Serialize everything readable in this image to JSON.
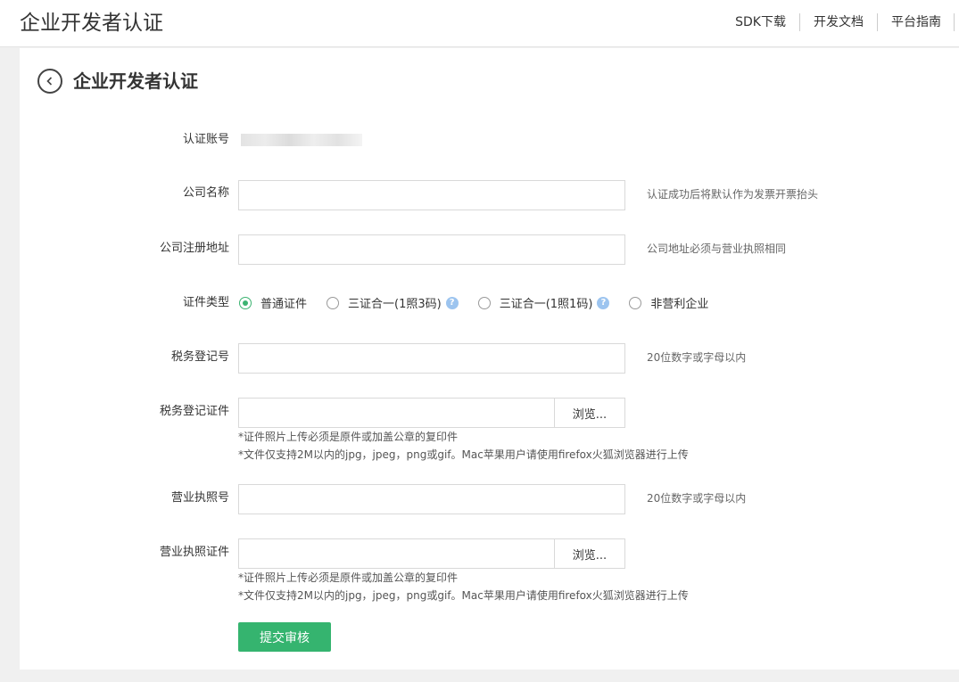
{
  "header": {
    "site_title": "企业开发者认证",
    "nav": [
      "SDK下载",
      "开发文档",
      "平台指南"
    ]
  },
  "page": {
    "title": "企业开发者认证"
  },
  "form": {
    "account": {
      "label": "认证账号"
    },
    "company_name": {
      "label": "公司名称",
      "value": "",
      "hint": "认证成功后将默认作为发票开票抬头"
    },
    "company_address": {
      "label": "公司注册地址",
      "value": "",
      "hint": "公司地址必须与营业执照相同"
    },
    "cert_type": {
      "label": "证件类型",
      "options": [
        "普通证件",
        "三证合一(1照3码)",
        "三证合一(1照1码)",
        "非营利企业"
      ],
      "selected": "普通证件"
    },
    "tax_no": {
      "label": "税务登记号",
      "value": "",
      "hint": "20位数字或字母以内"
    },
    "tax_cert": {
      "label": "税务登记证件",
      "browse": "浏览...",
      "note1": "*证件照片上传必须是原件或加盖公章的复印件",
      "note2": "*文件仅支持2M以内的jpg，jpeg，png或gif。Mac苹果用户请使用firefox火狐浏览器进行上传"
    },
    "license_no": {
      "label": "营业执照号",
      "value": "",
      "hint": "20位数字或字母以内"
    },
    "license_cert": {
      "label": "营业执照证件",
      "browse": "浏览...",
      "note1": "*证件照片上传必须是原件或加盖公章的复印件",
      "note2": "*文件仅支持2M以内的jpg，jpeg，png或gif。Mac苹果用户请使用firefox火狐浏览器进行上传"
    },
    "submit": "提交审核"
  },
  "colors": {
    "accent": "#35b46f",
    "help_icon": "#9cc4ef"
  }
}
